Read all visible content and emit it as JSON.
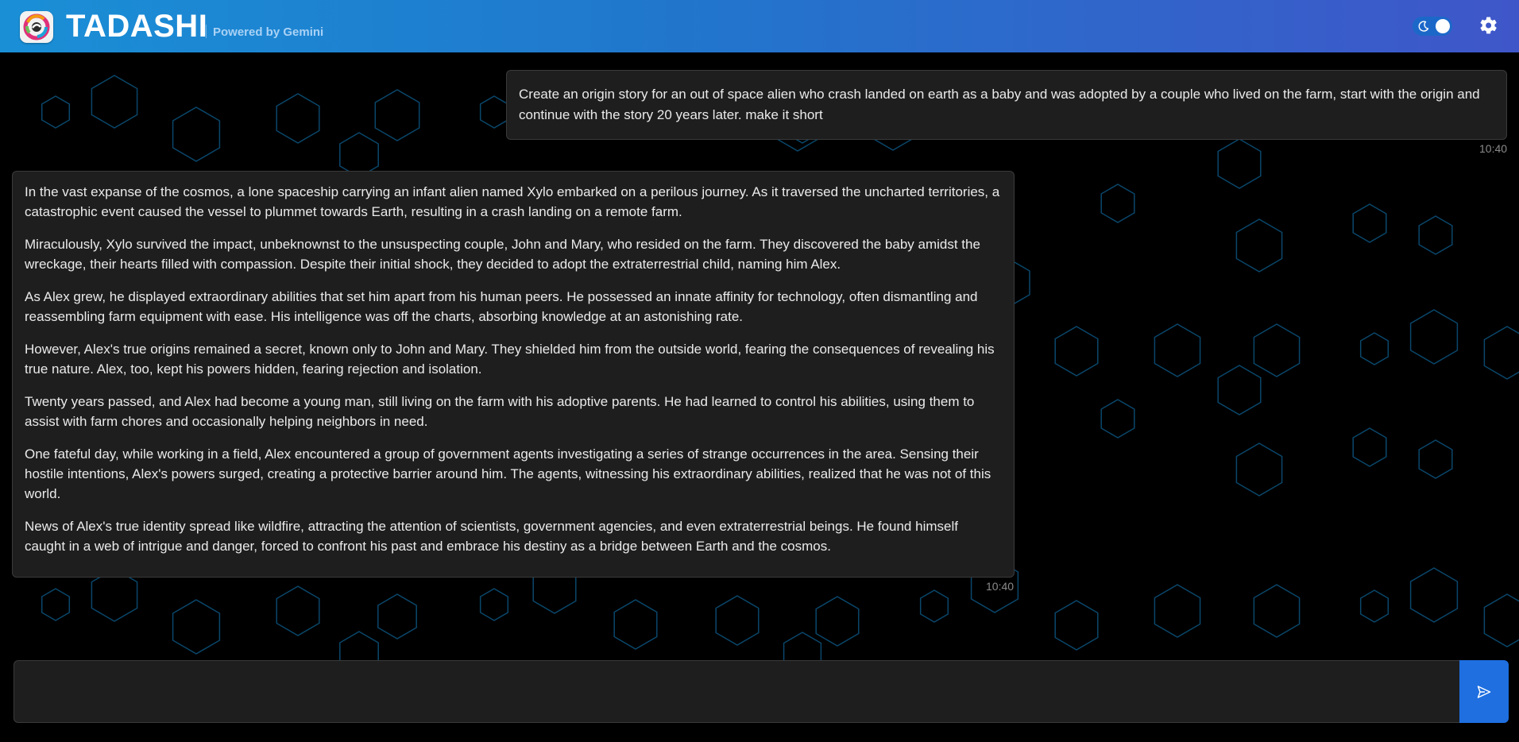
{
  "header": {
    "brand": "TADASHI",
    "powered_by": "Powered by Gemini",
    "theme_toggle_state": "dark",
    "colors": {
      "gradient_start": "#1a8fd6",
      "gradient_end": "#3f56c9"
    }
  },
  "icons": {
    "logo": "tadashi-logo-icon",
    "theme": "moon-icon",
    "settings": "gear-icon",
    "send": "send-icon"
  },
  "chat": {
    "messages": [
      {
        "role": "user",
        "text": "Create an origin story for an out of space alien who crash landed on earth as a baby and was adopted by a couple who lived on the farm, start with the origin and continue with the story 20 years later. make it short",
        "time": "10:40"
      },
      {
        "role": "assistant",
        "paragraphs": [
          "In the vast expanse of the cosmos, a lone spaceship carrying an infant alien named Xylo embarked on a perilous journey. As it traversed the uncharted territories, a catastrophic event caused the vessel to plummet towards Earth, resulting in a crash landing on a remote farm.",
          "Miraculously, Xylo survived the impact, unbeknownst to the unsuspecting couple, John and Mary, who resided on the farm. They discovered the baby amidst the wreckage, their hearts filled with compassion. Despite their initial shock, they decided to adopt the extraterrestrial child, naming him Alex.",
          "As Alex grew, he displayed extraordinary abilities that set him apart from his human peers. He possessed an innate affinity for technology, often dismantling and reassembling farm equipment with ease. His intelligence was off the charts, absorbing knowledge at an astonishing rate.",
          "However, Alex's true origins remained a secret, known only to John and Mary. They shielded him from the outside world, fearing the consequences of revealing his true nature. Alex, too, kept his powers hidden, fearing rejection and isolation.",
          "Twenty years passed, and Alex had become a young man, still living on the farm with his adoptive parents. He had learned to control his abilities, using them to assist with farm chores and occasionally helping neighbors in need.",
          "One fateful day, while working in a field, Alex encountered a group of government agents investigating a series of strange occurrences in the area. Sensing their hostile intentions, Alex's powers surged, creating a protective barrier around him. The agents, witnessing his extraordinary abilities, realized that he was not of this world.",
          "News of Alex's true identity spread like wildfire, attracting the attention of scientists, government agencies, and even extraterrestrial beings. He found himself caught in a web of intrigue and danger, forced to confront his past and embrace his destiny as a bridge between Earth and the cosmos."
        ],
        "time": "10:40"
      }
    ]
  },
  "composer": {
    "value": "",
    "placeholder": ""
  },
  "theme_colors": {
    "background": "#000000",
    "bubble": "#1e1e1e",
    "hexagon_stroke": "#0e5f8f",
    "send_button": "#1f6fe0"
  }
}
